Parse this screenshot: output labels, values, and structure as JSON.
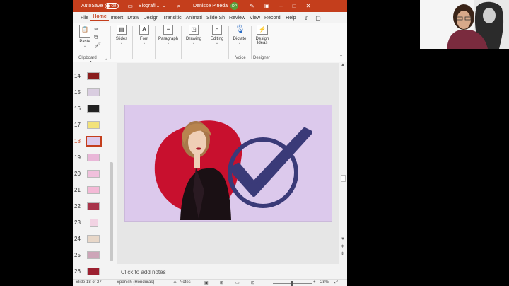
{
  "window": {
    "autosave_label": "AutoSave",
    "autosave_state": "Off",
    "filename": "Biografi...",
    "user_name": "Denisse Pineda",
    "user_initials": "DP"
  },
  "tabs": [
    "File",
    "Home",
    "Insert",
    "Draw",
    "Design",
    "Transitic",
    "Animati",
    "Slide Sh",
    "Review",
    "View",
    "Recordi",
    "Help"
  ],
  "ribbon": {
    "paste": "Paste",
    "clipboard": "Clipboard",
    "slides": "Slides",
    "font": "Font",
    "paragraph": "Paragraph",
    "drawing": "Drawing",
    "editing": "Editing",
    "dictate": "Dictate",
    "voice": "Voice",
    "design_ideas_1": "Design",
    "design_ideas_2": "Ideas",
    "designer": "Designer"
  },
  "thumbnails": {
    "numbers": [
      "14",
      "15",
      "16",
      "17",
      "18",
      "19",
      "20",
      "21",
      "22",
      "23",
      "24",
      "25",
      "26"
    ],
    "selected": "18"
  },
  "notes_placeholder": "Click to add notes",
  "status": {
    "slide_info": "Slide 18 of 27",
    "language": "Spanish (Honduras)",
    "notes_button": "Notes",
    "zoom": "28%"
  },
  "colors": {
    "accent": "#c43e1c",
    "slide_bg": "#dcc9ec",
    "check_color": "#3a3a78",
    "blob_color": "#c8102e"
  }
}
